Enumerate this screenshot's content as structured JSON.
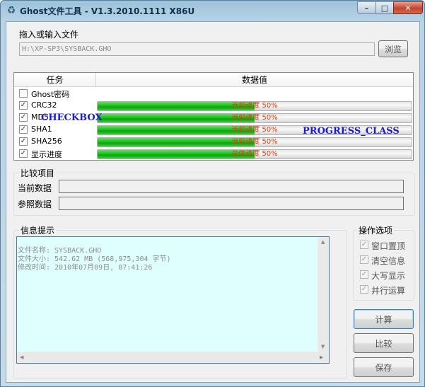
{
  "window": {
    "title": "Ghost文件工具 - V1.3.2010.1111 X86U",
    "controls": {
      "minimize": "–",
      "maximize": "□",
      "close": "✕"
    }
  },
  "file_section": {
    "label": "拖入或输入文件",
    "path_value": "H:\\XP-SP3\\SYSBACK.GHO",
    "browse_label": "浏览"
  },
  "task_list": {
    "col_task": "任务",
    "col_value": "数据值",
    "rows": [
      {
        "label": "Ghost密码",
        "checked": false,
        "progress": null,
        "text": ""
      },
      {
        "label": "CRC32",
        "checked": true,
        "progress": 0.5,
        "text": "当前进度 50%"
      },
      {
        "label": "MD5",
        "checked": true,
        "progress": 0.5,
        "text": "当前进度 50%"
      },
      {
        "label": "SHA1",
        "checked": true,
        "progress": 0.5,
        "text": "当前进度 50%"
      },
      {
        "label": "SHA256",
        "checked": true,
        "progress": 0.5,
        "text": "当前进度 50%"
      },
      {
        "label": "显示进度",
        "checked": true,
        "progress": 0.5,
        "text": "总体进度 50%"
      }
    ],
    "overlay_checkbox": "CHECKBOX",
    "overlay_progress": "PROGRESS_CLASS"
  },
  "compare": {
    "title": "比较项目",
    "current_label": "当前数据",
    "reference_label": "参照数据",
    "current_value": "",
    "reference_value": ""
  },
  "info": {
    "title": "信息提示",
    "lines": "文件名称: SYSBACK.GHO\n文件大小: 542.62 MB (568,975,304 字节)\n修改时间: 2010年07月09日, 07:41:26"
  },
  "options": {
    "title": "操作选项",
    "items": [
      {
        "label": "窗口置顶",
        "checked": true
      },
      {
        "label": "清空信息",
        "checked": true
      },
      {
        "label": "大写显示",
        "checked": true
      },
      {
        "label": "并行运算",
        "checked": true
      }
    ]
  },
  "actions": {
    "compute_label": "计算",
    "compare_label": "比较",
    "save_label": "保存"
  },
  "colors": {
    "progress_fill": "#1fc61f",
    "progress_text": "#e03c14",
    "overlay_text": "#1c1cc8",
    "info_bg": "#dffefe"
  }
}
